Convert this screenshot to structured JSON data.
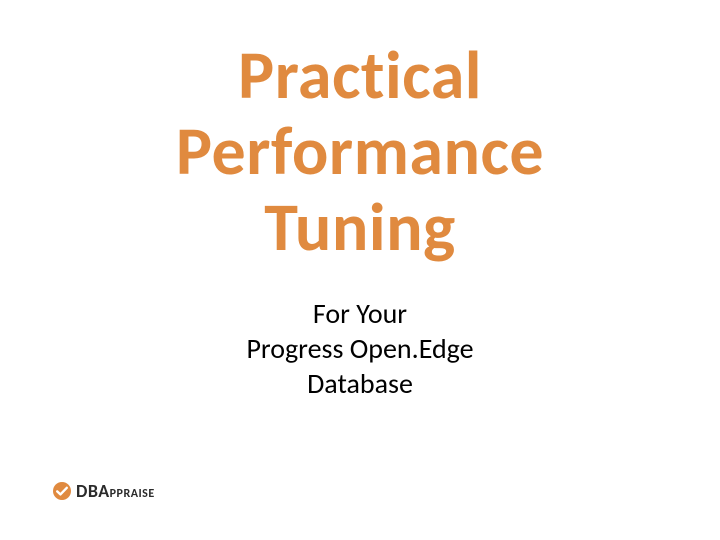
{
  "slide": {
    "title_line1": "Practical",
    "title_line2": "Performance",
    "title_line3": "Tuning",
    "subtitle_line1": "For Your",
    "subtitle_line2": "Progress Open.Edge",
    "subtitle_line3": "Database"
  },
  "logo": {
    "text_big": "DBA",
    "text_small": "PPRAISE"
  },
  "colors": {
    "title": "#e08a3f",
    "subtitle": "#000000",
    "logo_mark": "#e08a3f",
    "logo_check": "#ffffff",
    "logo_text": "#2b2b2b"
  }
}
